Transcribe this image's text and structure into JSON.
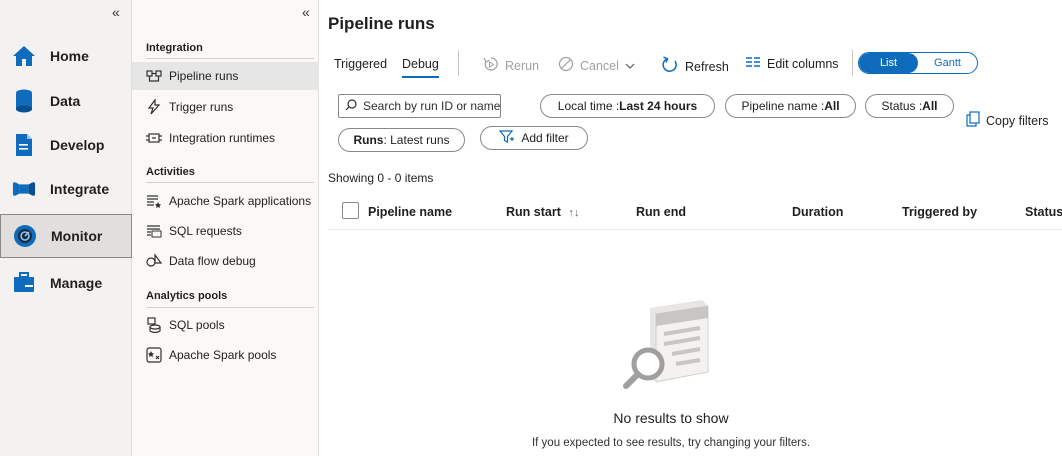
{
  "left_nav": {
    "collapse_glyph": "«",
    "items": [
      {
        "label": "Home",
        "icon": "home-icon"
      },
      {
        "label": "Data",
        "icon": "data-icon"
      },
      {
        "label": "Develop",
        "icon": "develop-icon"
      },
      {
        "label": "Integrate",
        "icon": "integrate-icon"
      },
      {
        "label": "Monitor",
        "icon": "monitor-icon",
        "active": true
      },
      {
        "label": "Manage",
        "icon": "manage-icon"
      }
    ]
  },
  "sub_nav": {
    "collapse_glyph": "«",
    "sections": [
      {
        "title": "Integration",
        "items": [
          {
            "label": "Pipeline runs",
            "icon": "pipeline-runs-icon",
            "active": true
          },
          {
            "label": "Trigger runs",
            "icon": "trigger-runs-icon"
          },
          {
            "label": "Integration runtimes",
            "icon": "integration-runtimes-icon"
          }
        ]
      },
      {
        "title": "Activities",
        "items": [
          {
            "label": "Apache Spark applications",
            "icon": "spark-applications-icon"
          },
          {
            "label": "SQL requests",
            "icon": "sql-requests-icon"
          },
          {
            "label": "Data flow debug",
            "icon": "data-flow-debug-icon"
          }
        ]
      },
      {
        "title": "Analytics pools",
        "items": [
          {
            "label": "SQL pools",
            "icon": "sql-pools-icon"
          },
          {
            "label": "Apache Spark pools",
            "icon": "spark-pools-icon"
          }
        ]
      }
    ]
  },
  "main": {
    "title": "Pipeline runs",
    "tabs": [
      {
        "label": "Triggered"
      },
      {
        "label": "Debug",
        "selected": true
      }
    ],
    "toolbar": {
      "rerun": "Rerun",
      "cancel": "Cancel",
      "refresh": "Refresh",
      "edit_columns": "Edit columns"
    },
    "view_toggle": {
      "list": "List",
      "gantt": "Gantt",
      "selected": "List"
    },
    "search": {
      "placeholder": "Search by run ID or name",
      "value": ""
    },
    "filters": {
      "time_label": "Local time : ",
      "time_value": "Last 24 hours",
      "pipeline_label": "Pipeline name : ",
      "pipeline_value": "All",
      "status_label": "Status : ",
      "status_value": "All",
      "runs_label": "Runs",
      "runs_value": " : Latest runs",
      "add_filter": "Add filter"
    },
    "copy_filters": "Copy filters",
    "showing": "Showing 0 - 0 items",
    "columns": [
      "Pipeline name",
      "Run start",
      "Run end",
      "Duration",
      "Triggered by",
      "Status"
    ],
    "sort_glyph": "↑↓",
    "empty": {
      "title": "No results to show",
      "subtitle": "If you expected to see results, try changing your filters."
    }
  },
  "colors": {
    "accent": "#0f6cbd",
    "nav_bg": "#f3f2f1"
  }
}
